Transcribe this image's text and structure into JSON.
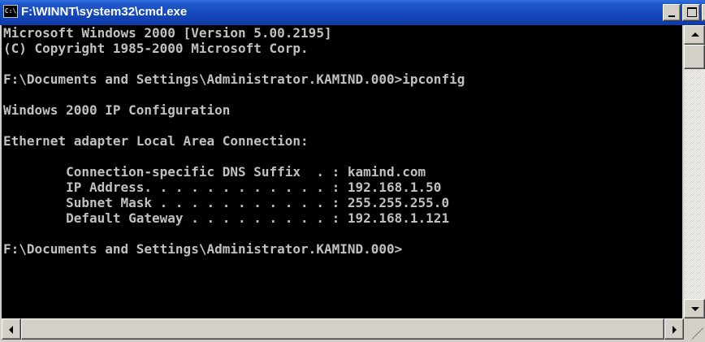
{
  "window": {
    "title": "F:\\WINNT\\system32\\cmd.exe",
    "icon_text": "C:\\",
    "close_glyph": "×"
  },
  "console": {
    "lines": [
      "Microsoft Windows 2000 [Version 5.00.2195]",
      "(C) Copyright 1985-2000 Microsoft Corp.",
      "",
      "F:\\Documents and Settings\\Administrator.KAMIND.000>ipconfig",
      "",
      "Windows 2000 IP Configuration",
      "",
      "Ethernet adapter Local Area Connection:",
      "",
      "        Connection-specific DNS Suffix  . : kamind.com",
      "        IP Address. . . . . . . . . . . . : 192.168.1.50",
      "        Subnet Mask . . . . . . . . . . . : 255.255.255.0",
      "        Default Gateway . . . . . . . . . : 192.168.1.121",
      "",
      "F:\\Documents and Settings\\Administrator.KAMIND.000>",
      "",
      "",
      "",
      ""
    ]
  },
  "colors": {
    "console_bg": "#000000",
    "console_text": "#c0c0c0",
    "titlebar": "#1346b9"
  },
  "icons": {
    "window_icon": "cmd-icon",
    "minimize": "minimize-icon",
    "maximize": "maximize-icon",
    "close": "close-icon"
  }
}
